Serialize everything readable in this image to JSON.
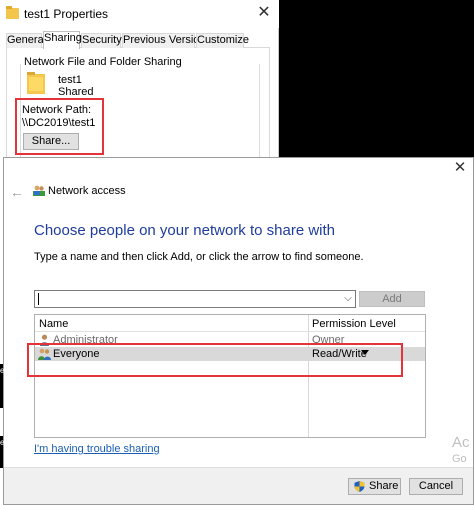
{
  "properties": {
    "title": "test1 Properties",
    "close_glyph": "✕",
    "tabs": [
      {
        "label": "General"
      },
      {
        "label": "Sharing"
      },
      {
        "label": "Security"
      },
      {
        "label": "Previous Versions"
      },
      {
        "label": "Customize"
      }
    ],
    "active_tab": "Sharing",
    "group_label": "Network File and Folder Sharing",
    "folder_name": "test1",
    "folder_status": "Shared",
    "network_path_label": "Network Path:",
    "network_path_value": "\\\\DC2019\\test1",
    "share_button": "Share..."
  },
  "dialog": {
    "close_glyph": "✕",
    "back_glyph": "←",
    "window_title": "Network access",
    "heading": "Choose people on your network to share with",
    "instruction": "Type a name and then click Add, or click the arrow to find someone.",
    "name_input_value": "",
    "combo_arrow_glyph": "⌵",
    "add_button": "Add",
    "columns": {
      "name": "Name",
      "permission": "Permission Level"
    },
    "rows": [
      {
        "name": "Administrator",
        "permission": "Owner",
        "selected": false
      },
      {
        "name": "Everyone",
        "permission": "Read/Write",
        "selected": true
      }
    ],
    "trouble_link": "I'm having trouble sharing",
    "share_button": "Share",
    "cancel_button": "Cancel"
  },
  "watermark": {
    "line1": "Ac",
    "line2": "Go"
  },
  "edge": {
    "dot1": "e",
    "dot2": "e"
  },
  "colors": {
    "heading_blue": "#1e3d9b",
    "link_blue": "#1a5fb4",
    "highlight_red": "#e5333a",
    "selected_row": "#d9d9d9"
  },
  "icons": {
    "folder": "folder-icon",
    "people": "people-icon",
    "user": "user-icon",
    "group": "group-icon",
    "shield": "uac-shield-icon"
  }
}
